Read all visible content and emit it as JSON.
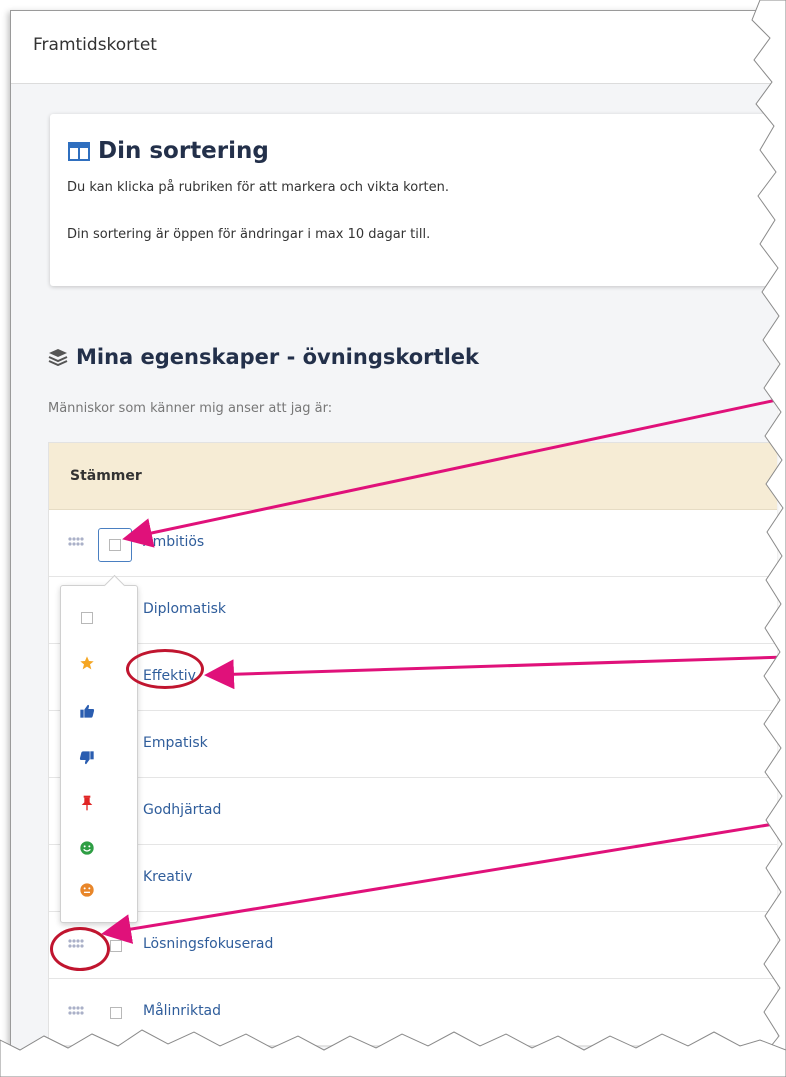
{
  "window": {
    "title": "Framtidskortet"
  },
  "intro": {
    "title": "Din sortering",
    "line1": "Du kan klicka på rubriken för att markera och vikta korten.",
    "line2": "Din sortering är öppen för ändringar i max 10 dagar till."
  },
  "section": {
    "title": "Mina egenskaper - övningskortlek",
    "subtitle": "Människor som känner mig anser att jag är:"
  },
  "table": {
    "header": "Stämmer",
    "rows": [
      {
        "label": "Ambitiös"
      },
      {
        "label": "Diplomatisk"
      },
      {
        "label": "Effektiv"
      },
      {
        "label": "Empatisk"
      },
      {
        "label": "Godhjärtad"
      },
      {
        "label": "Kreativ"
      },
      {
        "label": "Lösningsfokuserad"
      },
      {
        "label": "Målinriktad"
      }
    ]
  },
  "popup_options": [
    "empty-checkbox",
    "star-icon",
    "thumbs-up-icon",
    "thumbs-down-icon",
    "pin-icon",
    "smile-icon",
    "neutral-face-icon"
  ],
  "colors": {
    "accent": "#2f5d9b",
    "header_bg": "#f6ecd5",
    "annotation": "#e0117a",
    "circle": "#c0152f"
  }
}
